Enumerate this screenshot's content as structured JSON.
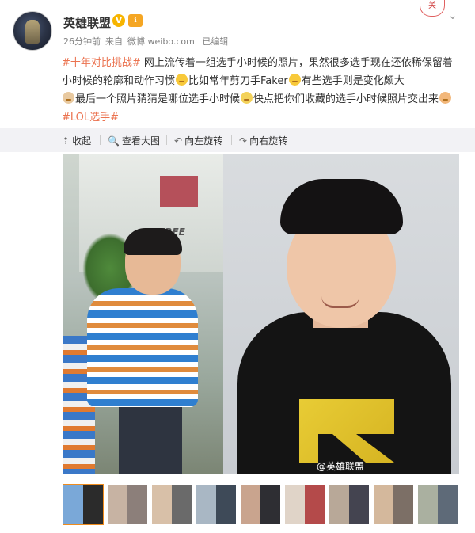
{
  "header": {
    "username": "英雄联盟",
    "verified_badge": "V",
    "level_badge": "ℹ",
    "time": "26分钟前",
    "source_prefix": "来自",
    "source": "微博 weibo.com",
    "edited": "已编辑",
    "stamp": "关",
    "chevron": "⌄"
  },
  "post": {
    "hashtag1": "#十年对比挑战#",
    "text1": " 网上流传着一组选手小时候的照片，果然很多选手现在还依稀保留着小时候的轮廓和动作习惯",
    "text2": "比如常年剪刀手Faker",
    "text3": "有些选手则是变化颇大",
    "text4": "最后一个照片猜猜是哪位选手小时候",
    "text5": "快点把你们收藏的选手小时候照片交出来",
    "hashtag2": "#LOL选手#"
  },
  "toolbar": {
    "collapse": "收起",
    "view_large": "查看大图",
    "rotate_left": "向左旋转",
    "rotate_right": "向右旋转",
    "collapse_icon": "⇡",
    "view_icon": "🔍",
    "rotate_left_icon": "↶",
    "rotate_right_icon": "↷"
  },
  "photo": {
    "watermark": "@英雄联盟",
    "wall_text": "FREE",
    "thumbs": [
      {
        "a": "#7aa8d8",
        "b": "#2b2b2b"
      },
      {
        "a": "#c7b3a3",
        "b": "#8c7f7a"
      },
      {
        "a": "#d8c0a8",
        "b": "#6a6a6a"
      },
      {
        "a": "#a9b7c4",
        "b": "#3e4a58"
      },
      {
        "a": "#c9a48e",
        "b": "#2e2e33"
      },
      {
        "a": "#e0d4c8",
        "b": "#b44a4a"
      },
      {
        "a": "#b8a898",
        "b": "#444450"
      },
      {
        "a": "#d4b89c",
        "b": "#7c6f66"
      },
      {
        "a": "#aab0a0",
        "b": "#5e6a78"
      }
    ]
  },
  "colors": {
    "link": "#eb7350",
    "toolbar_bg": "#f2f2f5",
    "thumb_selected": "#f08c1c"
  }
}
